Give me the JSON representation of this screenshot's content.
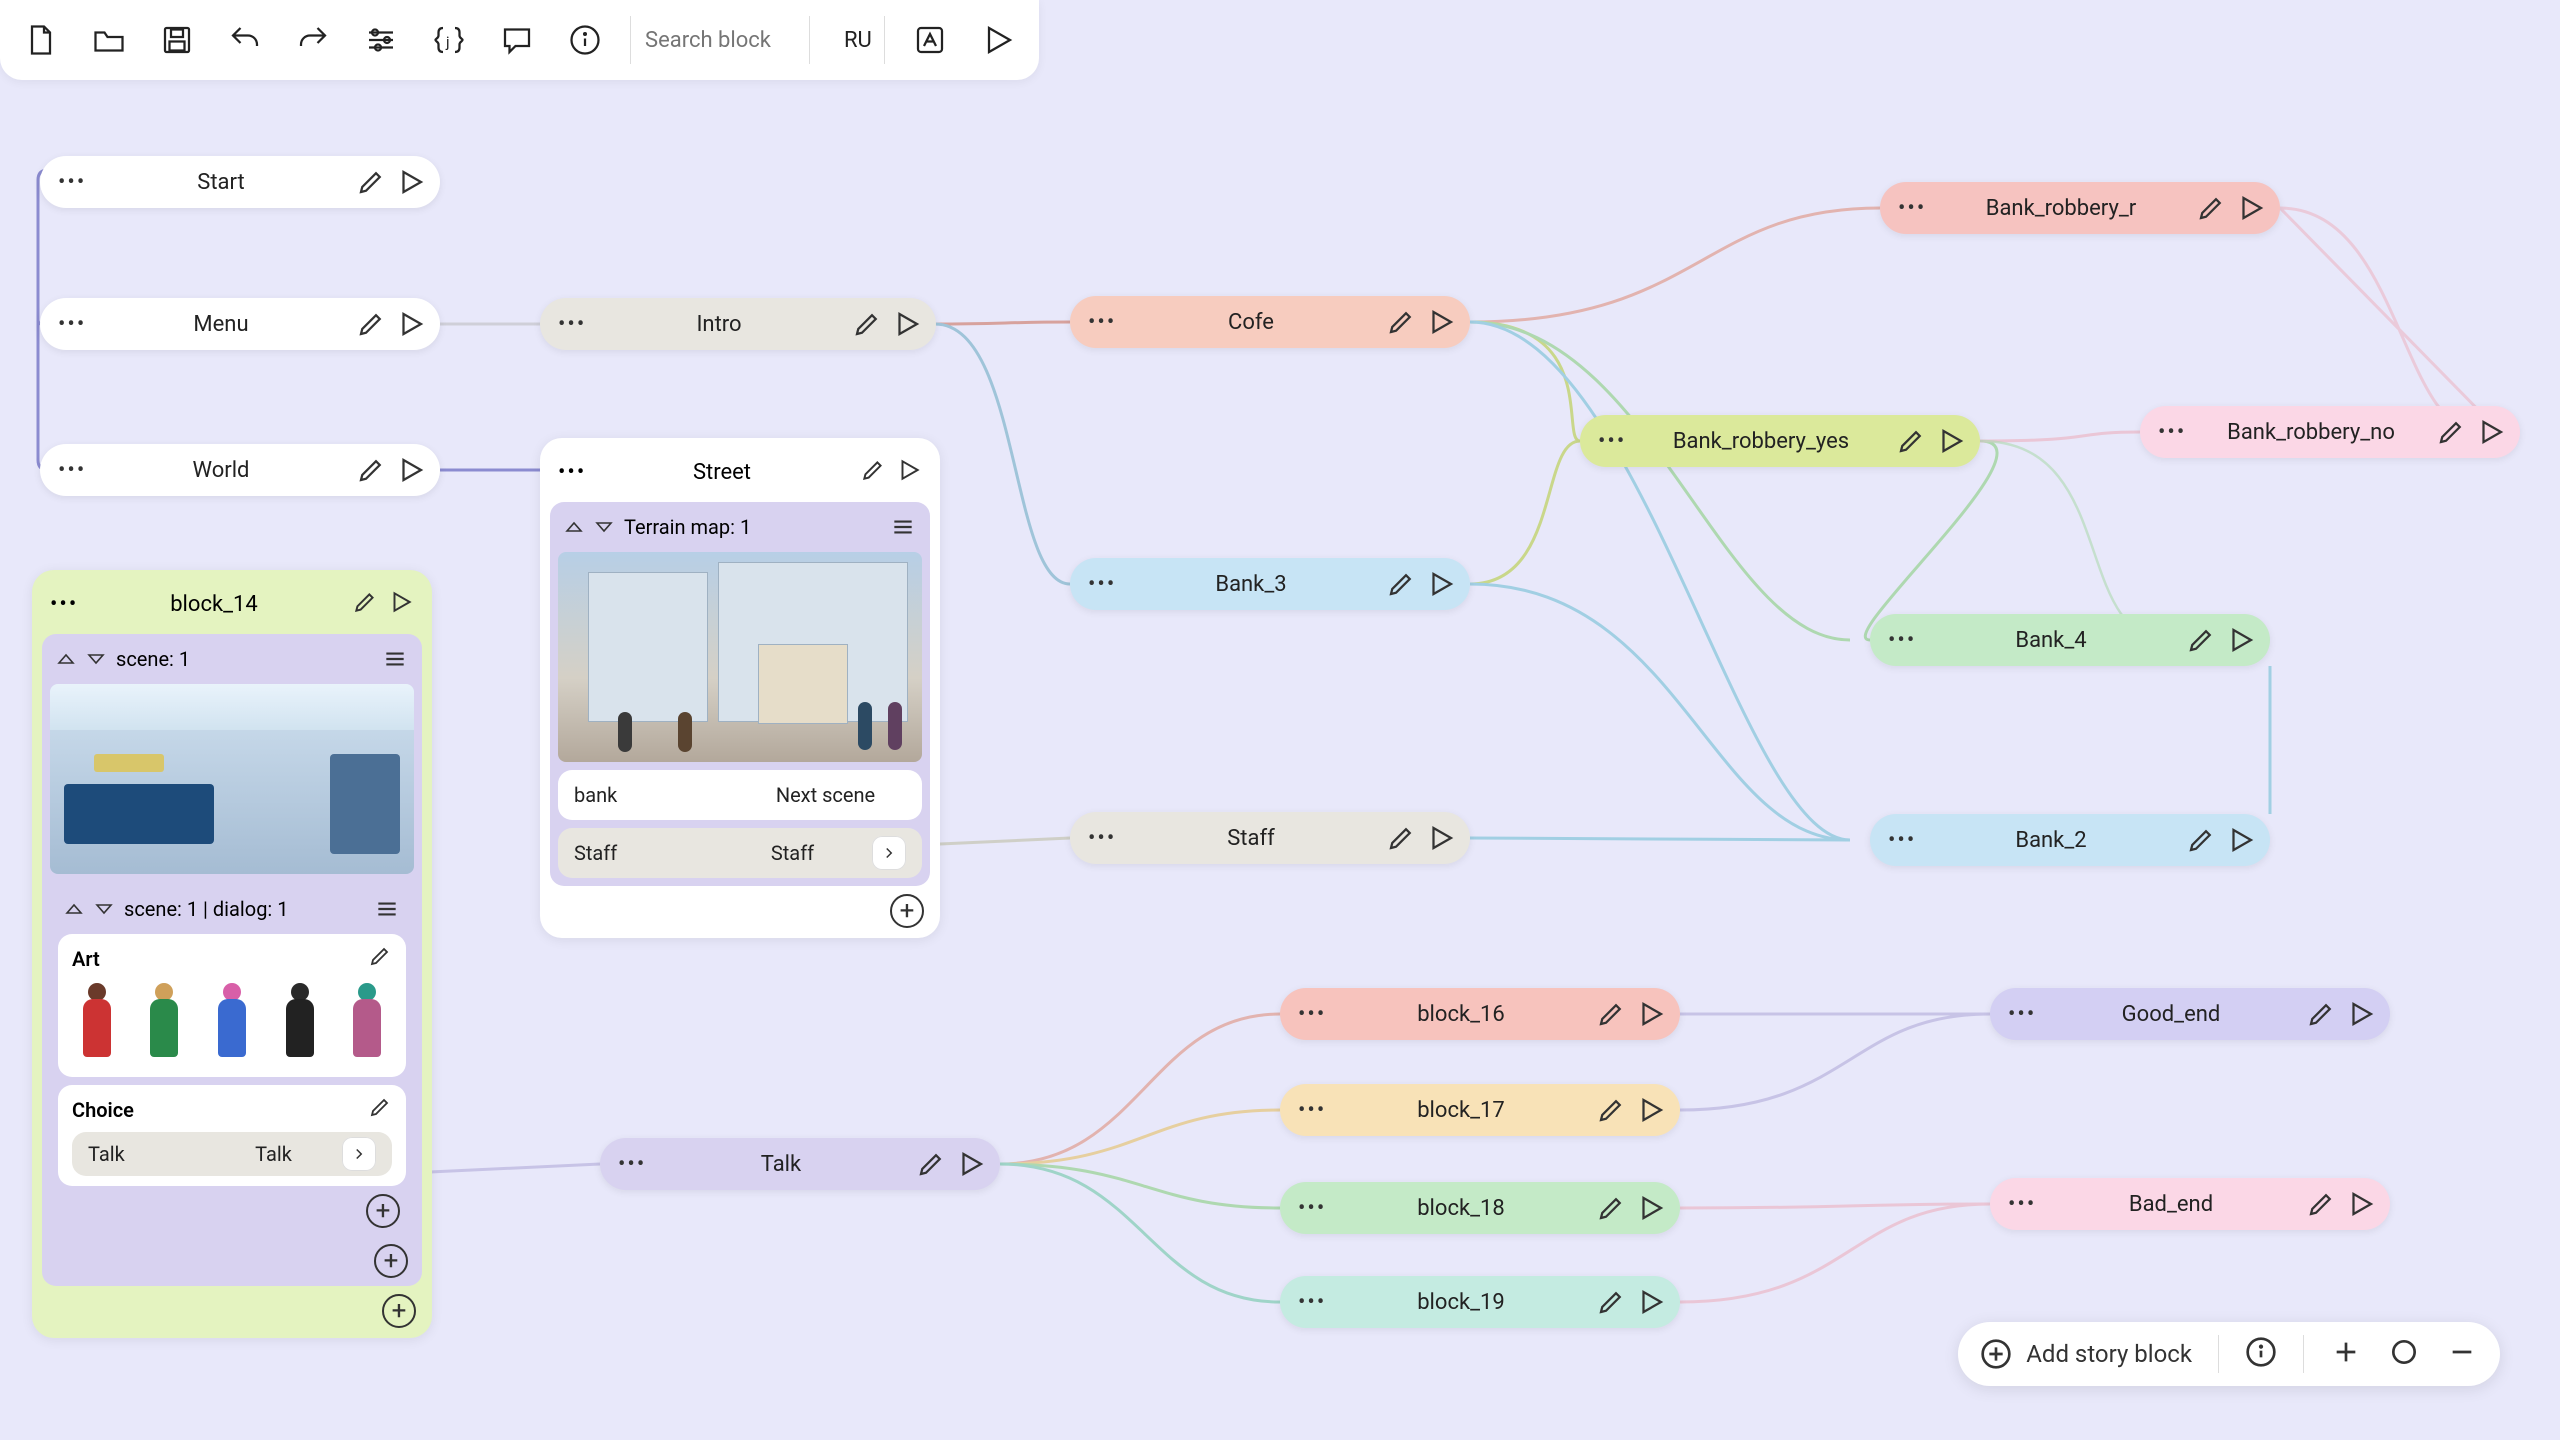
{
  "toolbar": {
    "search_placeholder": "Search block",
    "language": "RU"
  },
  "bottom_bar": {
    "add_label": "Add story block"
  },
  "nodes": {
    "start": {
      "label": "Start"
    },
    "menu": {
      "label": "Menu"
    },
    "world": {
      "label": "World"
    },
    "intro": {
      "label": "Intro"
    },
    "cofe": {
      "label": "Cofe"
    },
    "bank3": {
      "label": "Bank_3"
    },
    "staff": {
      "label": "Staff"
    },
    "talk": {
      "label": "Talk"
    },
    "brob_r": {
      "label": "Bank_robbery_r"
    },
    "brob_yes": {
      "label": "Bank_robbery_yes"
    },
    "brob_no": {
      "label": "Bank_robbery_no"
    },
    "bank4": {
      "label": "Bank_4"
    },
    "bank2": {
      "label": "Bank_2"
    },
    "b16": {
      "label": "block_16"
    },
    "b17": {
      "label": "block_17"
    },
    "b18": {
      "label": "block_18"
    },
    "b19": {
      "label": "block_19"
    },
    "good": {
      "label": "Good_end"
    },
    "bad": {
      "label": "Bad_end"
    }
  },
  "card_block14": {
    "title": "block_14",
    "scene_title": "scene: 1",
    "dialog_title": "scene: 1 | dialog: 1",
    "art_heading": "Art",
    "choice_heading": "Choice",
    "choice_option_a": "Talk",
    "choice_option_b": "Talk"
  },
  "card_street": {
    "title": "Street",
    "map_title": "Terrain map: 1",
    "row1_a": "bank",
    "row1_b": "Next scene",
    "row2_a": "Staff",
    "row2_b": "Staff"
  }
}
